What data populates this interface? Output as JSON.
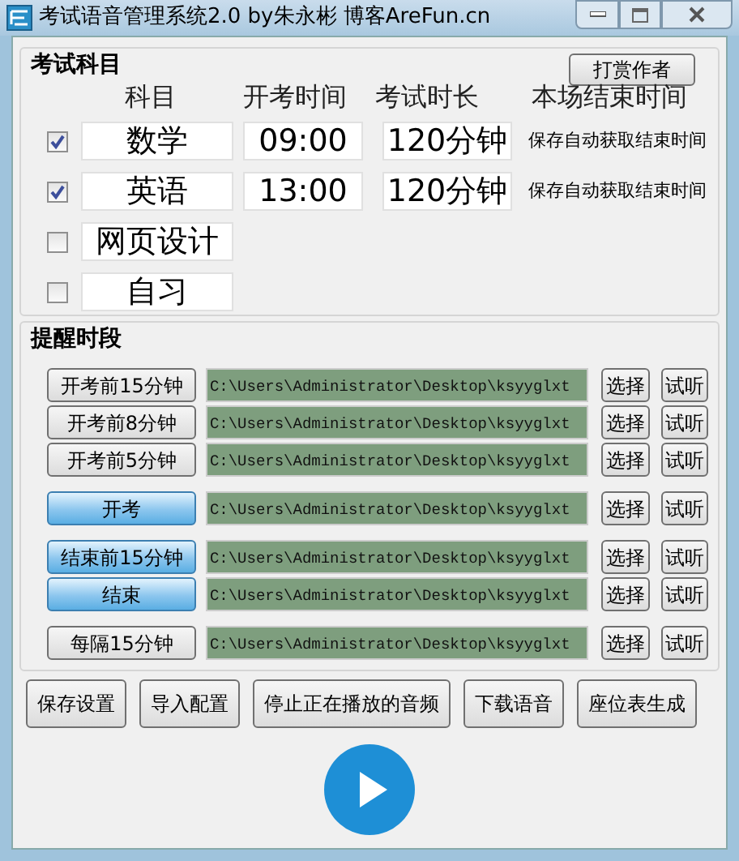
{
  "window": {
    "title": "考试语音管理系统2.0  by朱永彬 博客AreFun.cn"
  },
  "subjects_group": {
    "title": "考试科目",
    "reward_button": "打赏作者",
    "columns": [
      "科目",
      "开考时间",
      "考试时长",
      "本场结束时间"
    ],
    "rows": [
      {
        "checked": true,
        "subject": "数学",
        "start": "09:00",
        "duration": "120分钟",
        "end": "保存自动获取结束时间"
      },
      {
        "checked": true,
        "subject": "英语",
        "start": "13:00",
        "duration": "120分钟",
        "end": "保存自动获取结束时间"
      },
      {
        "checked": false,
        "subject": "网页设计"
      },
      {
        "checked": false,
        "subject": "自习"
      }
    ]
  },
  "reminders_group": {
    "title": "提醒时段",
    "rows": [
      {
        "label": "开考前15分钟",
        "highlighted": false,
        "path": "C:\\Users\\Administrator\\Desktop\\ksyyglxt",
        "choose": "选择",
        "preview": "试听"
      },
      {
        "label": "开考前8分钟",
        "highlighted": false,
        "path": "C:\\Users\\Administrator\\Desktop\\ksyyglxt",
        "choose": "选择",
        "preview": "试听"
      },
      {
        "label": "开考前5分钟",
        "highlighted": false,
        "path": "C:\\Users\\Administrator\\Desktop\\ksyyglxt",
        "choose": "选择",
        "preview": "试听"
      },
      {
        "label": "开考",
        "highlighted": true,
        "path": "C:\\Users\\Administrator\\Desktop\\ksyyglxt",
        "choose": "选择",
        "preview": "试听"
      },
      {
        "label": "结束前15分钟",
        "highlighted": true,
        "path": "C:\\Users\\Administrator\\Desktop\\ksyyglxt",
        "choose": "选择",
        "preview": "试听"
      },
      {
        "label": "结束",
        "highlighted": true,
        "path": "C:\\Users\\Administrator\\Desktop\\ksyyglxt",
        "choose": "选择",
        "preview": "试听"
      },
      {
        "label": "每隔15分钟",
        "highlighted": false,
        "path": "C:\\Users\\Administrator\\Desktop\\ksyyglxt",
        "choose": "选择",
        "preview": "试听"
      }
    ]
  },
  "buttons": [
    "保存设置",
    "导入配置",
    "停止正在播放的音频",
    "下载语音",
    "座位表生成"
  ]
}
